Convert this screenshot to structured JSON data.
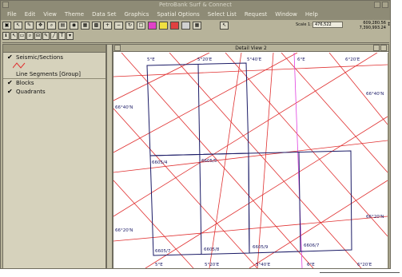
{
  "window": {
    "title": "PetroBank Surf & Connect"
  },
  "menu": [
    "File",
    "Edit",
    "View",
    "Theme",
    "Data Set",
    "Graphics",
    "Spatial Options",
    "Select List",
    "Request",
    "Window",
    "Help"
  ],
  "toolbar": {
    "scale_label": "Scale 1:",
    "scale_value": "476,522",
    "coord_x": "609,280.56",
    "coord_y": "7,390,993.24",
    "row1_icons": [
      "open-icon",
      "select-icon",
      "tool-icon",
      "pan-icon",
      "find-icon",
      "table-icon",
      "globe-icon",
      "layer-icon",
      "grid-icon",
      "zoom-in-icon",
      "zoom-out-icon",
      "refresh-icon",
      "page-icon",
      "color-magenta-icon",
      "color-yellow-icon",
      "color-red-icon",
      "color-gray-icon",
      "grid2-icon",
      "cursor-icon"
    ],
    "row2_icons": [
      "info-icon",
      "arrow-icon",
      "rect-icon",
      "zoom-icon",
      "measure-icon",
      "draw-icon",
      "line-icon",
      "text-icon",
      "dropdown-icon"
    ]
  },
  "legend": {
    "items": [
      {
        "label": "Seismic/Sections",
        "checked": true
      },
      {
        "label": "Line Segments [Group]",
        "checked": false
      },
      {
        "label": "Blocks",
        "checked": true
      },
      {
        "label": "Quadrants",
        "checked": true
      }
    ],
    "line_color": "#e03030"
  },
  "map": {
    "title": "Detail View 2",
    "top_labels": [
      "5°E",
      "5°20'E",
      "5°40'E",
      "6°E",
      "6°20'E"
    ],
    "bottom_labels": [
      "5°E",
      "5°20'E",
      "5°40'E",
      "6°E",
      "6°20'E"
    ],
    "left_labels": [
      "66°40'N",
      "66°20'N"
    ],
    "right_labels": [
      "66°40'N",
      "66°20'N"
    ],
    "block_labels": [
      "6605/4",
      "6605/5",
      "6605/7",
      "6605/8",
      "6605/9",
      "6606/7"
    ],
    "colors": {
      "seismic": "#e03030",
      "blocks": "#1a1a66",
      "quadrant": "#e040e0"
    }
  }
}
